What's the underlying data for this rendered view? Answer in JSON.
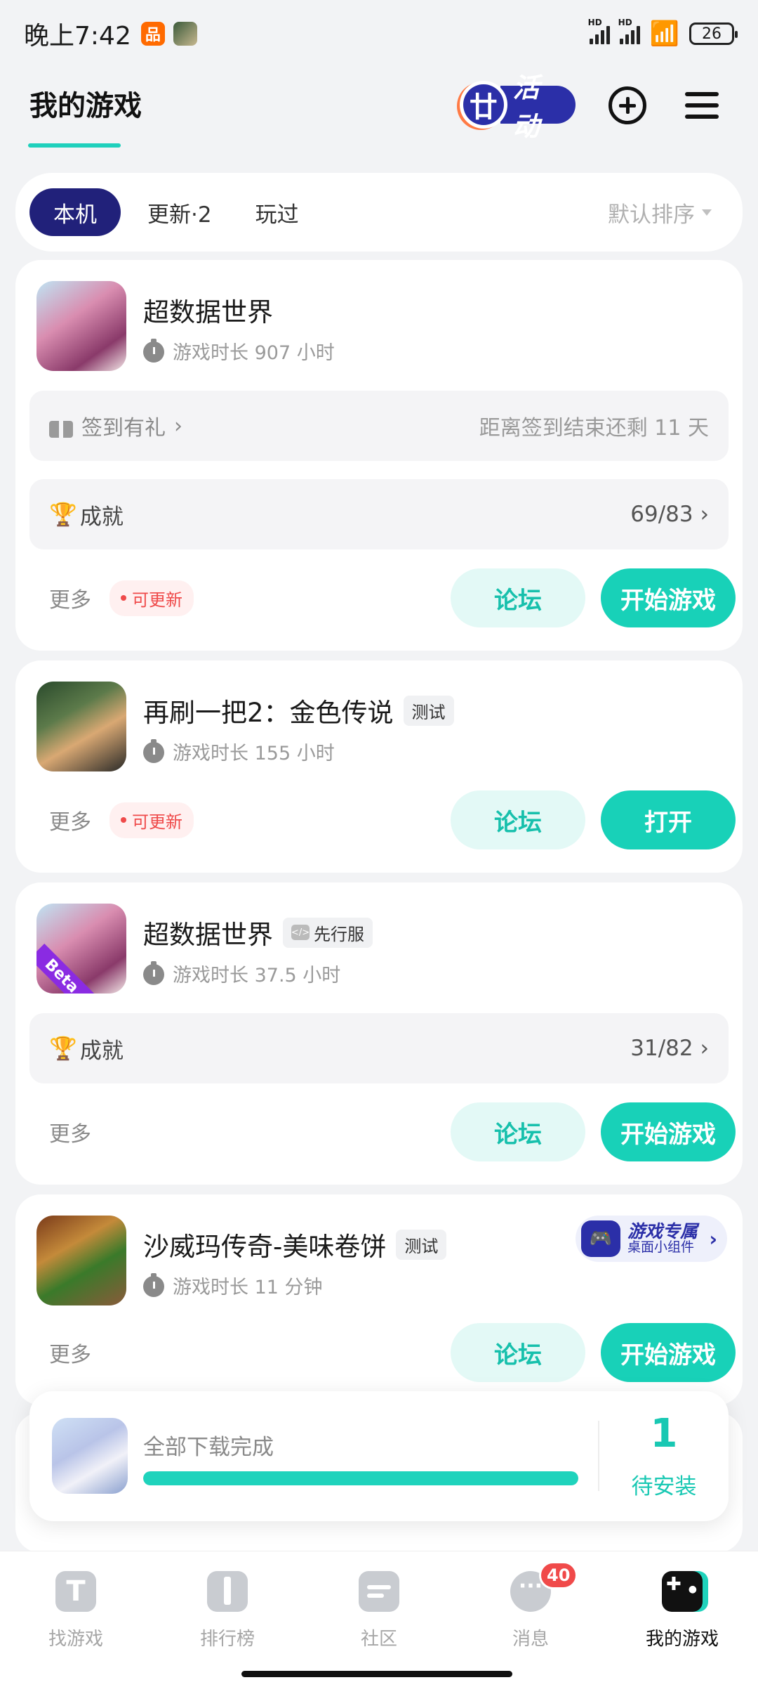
{
  "status_bar": {
    "time": "晚上7:42",
    "battery": "26",
    "notif_orange_glyph": "品"
  },
  "header": {
    "title": "我的游戏",
    "activity_icon_glyph": "廿",
    "activity_word": "活动",
    "icons": [
      "add-circle-icon",
      "menu-icon"
    ]
  },
  "filter": {
    "tabs": [
      "本机",
      "更新·2",
      "玩过"
    ],
    "active_tab": "本机",
    "sort_label": "默认排序"
  },
  "games": [
    {
      "name": "超数据世界",
      "playtime": "游戏时长 907 小时",
      "gift_label": "签到有礼",
      "gift_right": "距离签到结束还剩 11 天",
      "achievement_label": "成就",
      "achievement_count": "69/83",
      "more": "更多",
      "update_badge": "可更新",
      "forum": "论坛",
      "primary": "开始游戏"
    },
    {
      "name": "再刷一把2：金色传说",
      "tag": "测试",
      "playtime": "游戏时长 155 小时",
      "more": "更多",
      "update_badge": "可更新",
      "forum": "论坛",
      "primary": "打开"
    },
    {
      "name": "超数据世界",
      "tag": "先行服",
      "icon_badge": "Beta",
      "playtime": "游戏时长 37.5 小时",
      "achievement_label": "成就",
      "achievement_count": "31/82",
      "more": "更多",
      "forum": "论坛",
      "primary": "开始游戏"
    },
    {
      "name": "沙威玛传奇-美味卷饼",
      "tag": "测试",
      "playtime": "游戏时长 11 分钟",
      "widget_title": "游戏专属",
      "widget_sub": "桌面小组件",
      "more": "更多",
      "forum": "论坛",
      "primary": "开始游戏"
    }
  ],
  "download": {
    "text": "全部下载完成",
    "progress": 1.0,
    "count": "1",
    "count_label": "待安装"
  },
  "bottom_nav": {
    "items": [
      "找游戏",
      "排行榜",
      "社区",
      "消息",
      "我的游戏"
    ],
    "active": "我的游戏",
    "message_badge": "40"
  },
  "colors": {
    "accent": "#18d1b8",
    "active_tab": "#21217a",
    "update_red": "#ef4a4a"
  }
}
